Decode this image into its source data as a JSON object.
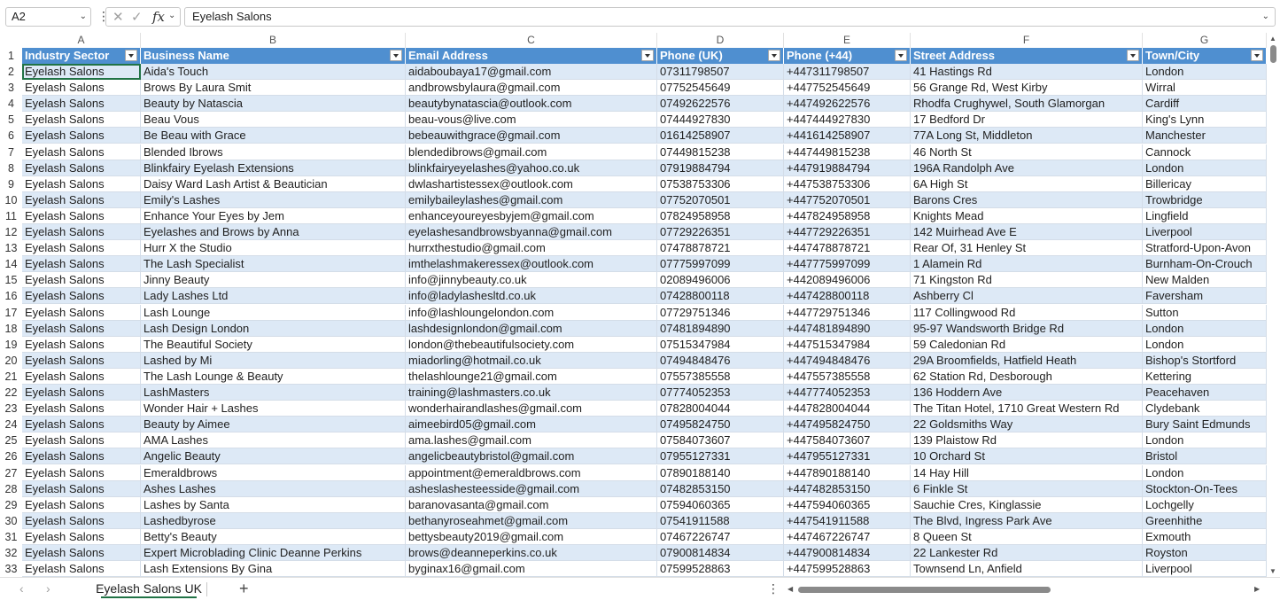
{
  "formula_bar": {
    "name_box": "A2",
    "fx_label": "fx",
    "formula_value": "Eyelash Salons"
  },
  "columns": [
    "A",
    "B",
    "C",
    "D",
    "E",
    "F",
    "G"
  ],
  "headers": [
    "Industry Sector",
    "Business Name",
    "Email Address",
    "Phone (UK)",
    "Phone (+44)",
    "Street Address",
    "Town/City"
  ],
  "rows": [
    {
      "n": "2",
      "cells": [
        "Eyelash Salons",
        "Aida's Touch",
        "aidaboubaya17@gmail.com",
        "07311798507",
        "+447311798507",
        "41 Hastings Rd",
        "London"
      ]
    },
    {
      "n": "3",
      "cells": [
        "Eyelash Salons",
        "Brows By Laura Smit",
        "andbrowsbylaura@gmail.com",
        "07752545649",
        "+447752545649",
        "56 Grange Rd, West Kirby",
        "Wirral"
      ]
    },
    {
      "n": "4",
      "cells": [
        "Eyelash Salons",
        "Beauty by Natascia",
        "beautybynatascia@outlook.com",
        "07492622576",
        "+447492622576",
        "Rhodfa Crughywel, South Glamorgan",
        "Cardiff"
      ]
    },
    {
      "n": "5",
      "cells": [
        "Eyelash Salons",
        "Beau Vous",
        "beau-vous@live.com",
        "07444927830",
        "+447444927830",
        "17 Bedford Dr",
        "King's Lynn"
      ]
    },
    {
      "n": "6",
      "cells": [
        "Eyelash Salons",
        "Be Beau with Grace",
        "bebeauwithgrace@gmail.com",
        "01614258907",
        "+441614258907",
        "77A Long St, Middleton",
        "Manchester"
      ]
    },
    {
      "n": "7",
      "cells": [
        "Eyelash Salons",
        "Blended Ibrows",
        "blendedibrows@gmail.com",
        "07449815238",
        "+447449815238",
        "46 North St",
        "Cannock"
      ]
    },
    {
      "n": "8",
      "cells": [
        "Eyelash Salons",
        "Blinkfairy Eyelash Extensions",
        "blinkfairyeyelashes@yahoo.co.uk",
        "07919884794",
        "+447919884794",
        "196A Randolph Ave",
        "London"
      ]
    },
    {
      "n": "9",
      "cells": [
        "Eyelash Salons",
        "Daisy Ward Lash Artist & Beautician",
        "dwlashartistessex@outlook.com",
        "07538753306",
        "+447538753306",
        "6A High St",
        "Billericay"
      ]
    },
    {
      "n": "10",
      "cells": [
        "Eyelash Salons",
        "Emily's Lashes",
        "emilybaileylashes@gmail.com",
        "07752070501",
        "+447752070501",
        "Barons Cres",
        "Trowbridge"
      ]
    },
    {
      "n": "11",
      "cells": [
        "Eyelash Salons",
        "Enhance Your Eyes by Jem",
        "enhanceyoureyesbyjem@gmail.com",
        "07824958958",
        "+447824958958",
        "Knights Mead",
        "Lingfield"
      ]
    },
    {
      "n": "12",
      "cells": [
        "Eyelash Salons",
        "Eyelashes and Brows by Anna",
        "eyelashesandbrowsbyanna@gmail.com",
        "07729226351",
        "+447729226351",
        "142 Muirhead Ave E",
        "Liverpool"
      ]
    },
    {
      "n": "13",
      "cells": [
        "Eyelash Salons",
        "Hurr X the Studio",
        "hurrxthestudio@gmail.com",
        "07478878721",
        "+447478878721",
        "Rear Of, 31 Henley St",
        "Stratford-Upon-Avon"
      ]
    },
    {
      "n": "14",
      "cells": [
        "Eyelash Salons",
        "The Lash Specialist",
        "imthelashmakeressex@outlook.com",
        "07775997099",
        "+447775997099",
        "1 Alamein Rd",
        "Burnham-On-Crouch"
      ]
    },
    {
      "n": "15",
      "cells": [
        "Eyelash Salons",
        "Jinny Beauty",
        "info@jinnybeauty.co.uk",
        "02089496006",
        "+442089496006",
        "71 Kingston Rd",
        "New Malden"
      ]
    },
    {
      "n": "16",
      "cells": [
        "Eyelash Salons",
        "Lady Lashes Ltd",
        "info@ladylashesltd.co.uk",
        "07428800118",
        "+447428800118",
        "Ashberry Cl",
        "Faversham"
      ]
    },
    {
      "n": "17",
      "cells": [
        "Eyelash Salons",
        "Lash Lounge",
        "info@lashloungelondon.com",
        "07729751346",
        "+447729751346",
        "117 Collingwood Rd",
        "Sutton"
      ]
    },
    {
      "n": "18",
      "cells": [
        "Eyelash Salons",
        "Lash Design London",
        "lashdesignlondon@gmail.com",
        "07481894890",
        "+447481894890",
        "95-97 Wandsworth Bridge Rd",
        "London"
      ]
    },
    {
      "n": "19",
      "cells": [
        "Eyelash Salons",
        "The Beautiful Society",
        "london@thebeautifulsociety.com",
        "07515347984",
        "+447515347984",
        "59 Caledonian Rd",
        "London"
      ]
    },
    {
      "n": "20",
      "cells": [
        "Eyelash Salons",
        "Lashed by Mi",
        "miadorling@hotmail.co.uk",
        "07494848476",
        "+447494848476",
        "29A Broomfields, Hatfield Heath",
        "Bishop's Stortford"
      ]
    },
    {
      "n": "21",
      "cells": [
        "Eyelash Salons",
        "The Lash Lounge & Beauty",
        "thelashlounge21@gmail.com",
        "07557385558",
        "+447557385558",
        "62 Station Rd, Desborough",
        "Kettering"
      ]
    },
    {
      "n": "22",
      "cells": [
        "Eyelash Salons",
        "LashMasters",
        "training@lashmasters.co.uk",
        "07774052353",
        "+447774052353",
        "136 Hoddern Ave",
        "Peacehaven"
      ]
    },
    {
      "n": "23",
      "cells": [
        "Eyelash Salons",
        "Wonder Hair + Lashes",
        "wonderhairandlashes@gmail.com",
        "07828004044",
        "+447828004044",
        "The Titan Hotel, 1710 Great Western Rd",
        "Clydebank"
      ]
    },
    {
      "n": "24",
      "cells": [
        "Eyelash Salons",
        "Beauty by Aimee",
        "aimeebird05@gmail.com",
        "07495824750",
        "+447495824750",
        "22 Goldsmiths Way",
        "Bury Saint Edmunds"
      ]
    },
    {
      "n": "25",
      "cells": [
        "Eyelash Salons",
        "AMA Lashes",
        "ama.lashes@gmail.com",
        "07584073607",
        "+447584073607",
        "139 Plaistow Rd",
        "London"
      ]
    },
    {
      "n": "26",
      "cells": [
        "Eyelash Salons",
        "Angelic Beauty",
        "angelicbeautybristol@gmail.com",
        "07955127331",
        "+447955127331",
        "10 Orchard St",
        "Bristol"
      ]
    },
    {
      "n": "27",
      "cells": [
        "Eyelash Salons",
        "Emeraldbrows",
        "appointment@emeraldbrows.com",
        "07890188140",
        "+447890188140",
        "14 Hay Hill",
        "London"
      ]
    },
    {
      "n": "28",
      "cells": [
        "Eyelash Salons",
        "Ashes Lashes",
        "asheslashesteesside@gmail.com",
        "07482853150",
        "+447482853150",
        "6 Finkle St",
        "Stockton-On-Tees"
      ]
    },
    {
      "n": "29",
      "cells": [
        "Eyelash Salons",
        "Lashes by Santa",
        "baranovasanta@gmail.com",
        "07594060365",
        "+447594060365",
        "Sauchie Cres, Kinglassie",
        "Lochgelly"
      ]
    },
    {
      "n": "30",
      "cells": [
        "Eyelash Salons",
        "Lashedbyrose",
        "bethanyroseahmet@gmail.com",
        "07541911588",
        "+447541911588",
        "The Blvd, Ingress Park Ave",
        "Greenhithe"
      ]
    },
    {
      "n": "31",
      "cells": [
        "Eyelash Salons",
        "Betty's Beauty",
        "bettysbeauty2019@gmail.com",
        "07467226747",
        "+447467226747",
        "8 Queen St",
        "Exmouth"
      ]
    },
    {
      "n": "32",
      "cells": [
        "Eyelash Salons",
        "Expert Microblading Clinic Deanne Perkins",
        "brows@deanneperkins.co.uk",
        "07900814834",
        "+447900814834",
        "22 Lankester Rd",
        "Royston"
      ]
    },
    {
      "n": "33",
      "cells": [
        "Eyelash Salons",
        "Lash Extensions By Gina",
        "byginax16@gmail.com",
        "07599528863",
        "+447599528863",
        "Townsend Ln, Anfield",
        "Liverpool"
      ]
    }
  ],
  "sheet_tabs": {
    "active": "Eyelash Salons UK",
    "add_label": "+"
  },
  "colors": {
    "header_bg": "#4f8fd0",
    "band_bg": "#dde9f6",
    "accent": "#217346"
  }
}
